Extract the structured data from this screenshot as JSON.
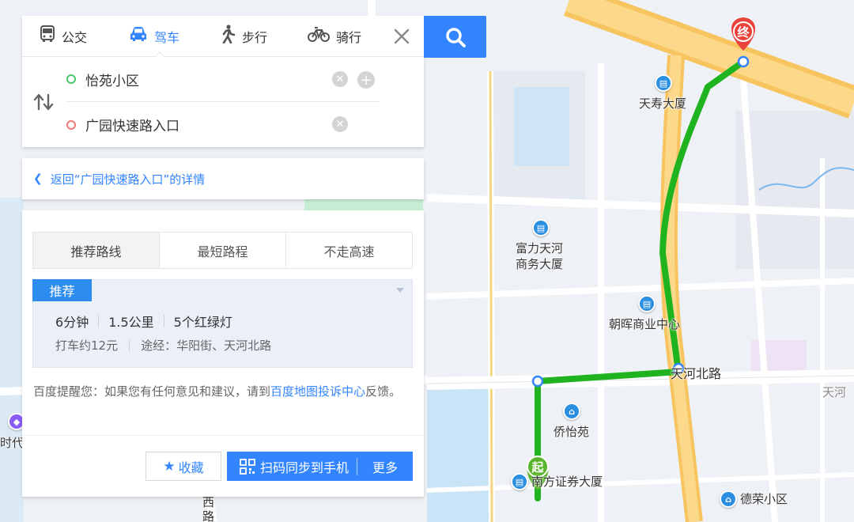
{
  "mode_tabs": [
    {
      "label": "公交",
      "icon": "bus-icon"
    },
    {
      "label": "驾车",
      "icon": "car-icon"
    },
    {
      "label": "步行",
      "icon": "walk-icon"
    },
    {
      "label": "骑行",
      "icon": "bike-icon"
    }
  ],
  "active_mode": "驾车",
  "route": {
    "start": "怡苑小区",
    "end": "广园快速路入口"
  },
  "back_link": "返回“广园快速路入口”的详情",
  "route_options": [
    "推荐路线",
    "最短路程",
    "不走高速"
  ],
  "active_route_option": "推荐路线",
  "recommended": {
    "badge": "推荐",
    "time_num": "6",
    "time_unit": "分钟",
    "distance_num": "1.5",
    "distance_unit": "公里",
    "lights_num": "5",
    "lights_unit": "个红绿灯",
    "taxi_prefix": "打车约",
    "taxi_num": "12",
    "taxi_unit": "元",
    "via": "途经：华阳街、天河北路"
  },
  "notice": {
    "prefix": "百度提醒您：如果您有任何意见和建议，请到",
    "link": "百度地图投诉中心",
    "suffix": "反馈。"
  },
  "buttons": {
    "favorite": "收藏",
    "sync": "扫码同步到手机",
    "more": "更多"
  },
  "map_labels": {
    "tianshou": "天寿大厦",
    "fuli_1": "富力天河",
    "fuli_2": "商务大厦",
    "zhaohui": "朝晖商业中心",
    "tianhe_north": "天河北路",
    "tianhe_edge": "天河",
    "qiaoyi": "侨怡苑",
    "securities": "南方证券大厦",
    "derong": "德荣小区",
    "west_road_1": "西",
    "west_road_2": "路",
    "shidai": "时代"
  },
  "markers": {
    "start": "起",
    "end": "终"
  },
  "colors": {
    "accent": "#3385ff",
    "route": "#1fb41f",
    "highway": "#fcd27a",
    "start_marker": "#59b52a",
    "end_marker": "#e8423a"
  }
}
